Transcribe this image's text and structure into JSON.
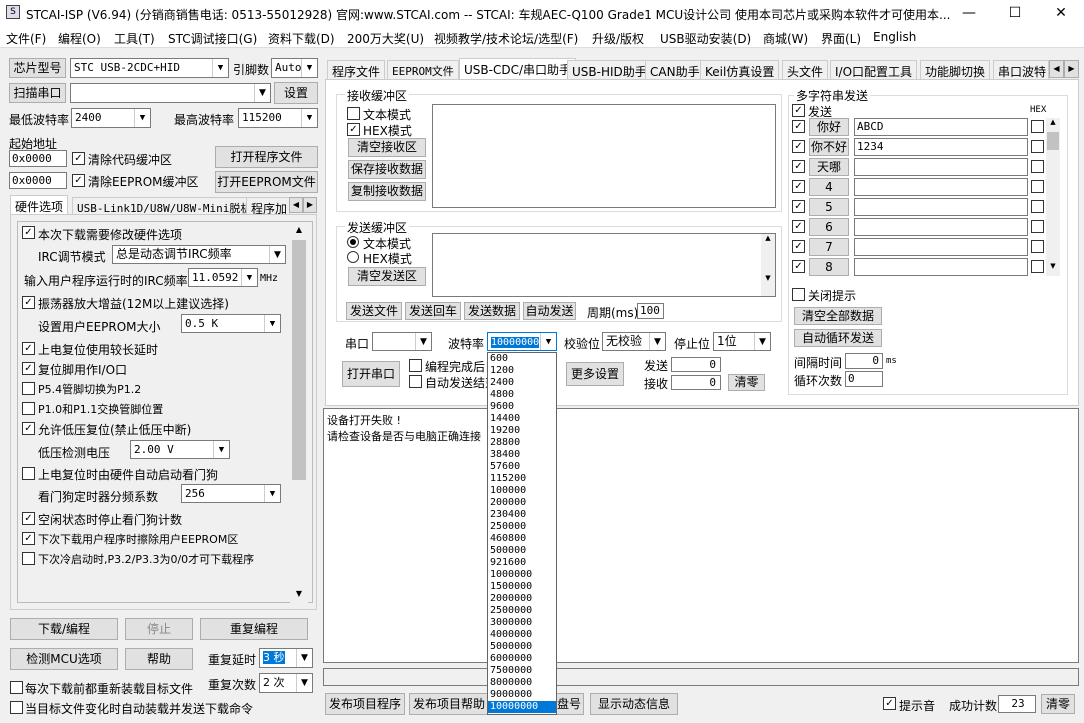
{
  "window": {
    "title": "STCAI-ISP (V6.94) (分销商销售电话: 0513-55012928) 官网:www.STCAI.com  -- STCAI: 车规AEC-Q100 Grade1 MCU设计公司 使用本司芯片或采购本软件才可使用本...",
    "min": "—",
    "max": "☐",
    "close": "✕"
  },
  "menu": [
    "文件(F)",
    "编程(O)",
    "工具(T)",
    "STC调试接口(G)",
    "资料下载(D)",
    "200万大奖(U)",
    "视频教学/技术论坛/选型(F)",
    "升级/版权",
    "USB驱动安装(D)",
    "商城(W)",
    "界面(L)",
    "English"
  ],
  "left": {
    "chip_btn": "芯片型号",
    "chip_value": "STC USB-2CDC+HID",
    "pin_label": "引脚数",
    "pin_value": "Auto",
    "scan_btn": "扫描串口",
    "port_value": "",
    "settings_btn": "设置",
    "min_baud_label": "最低波特率",
    "min_baud": "2400",
    "max_baud_label": "最高波特率",
    "max_baud": "115200",
    "start_addr_label": "起始地址",
    "addr1": "0x0000",
    "clear_code": "清除代码缓冲区",
    "open_prog": "打开程序文件",
    "addr2": "0x0000",
    "clear_eeprom": "清除EEPROM缓冲区",
    "open_eeprom": "打开EEPROM文件",
    "tabs": [
      "硬件选项",
      "USB-Link1D/U8W/U8W-Mini脱机",
      "程序加"
    ],
    "opt_modify": "本次下载需要修改硬件选项",
    "irc_mode_label": "IRC调节模式",
    "irc_mode": "总是动态调节IRC频率",
    "irc_freq_label": "输入用户程序运行时的IRC频率",
    "irc_freq": "11.0592",
    "irc_unit": "MHz",
    "osc_gain": "振荡器放大增益(12M以上建议选择)",
    "eeprom_size_label": "设置用户EEPROM大小",
    "eeprom_size": "0.5 K",
    "por_delay": "上电复位使用较长延时",
    "reset_io": "复位脚用作I/O口",
    "p54": "P5.4管脚切换为P1.2",
    "p10": "P1.0和P1.1交换管脚位置",
    "lvr": "允许低压复位(禁止低压中断)",
    "lvd_label": "低压检测电压",
    "lvd": "2.00 V",
    "wdt_auto": "上电复位时由硬件自动启动看门狗",
    "wdt_div_label": "看门狗定时器分频系数",
    "wdt_div": "256",
    "idle_wdt": "空闲状态时停止看门狗计数",
    "erase_eeprom": "下次下载用户程序时擦除用户EEPROM区",
    "p32": "下次冷启动时,P3.2/P3.3为0/0才可下载程序",
    "download_btn": "下载/编程",
    "stop_btn": "停止",
    "reprog_btn": "重复编程",
    "detect_btn": "检测MCU选项",
    "help_btn": "帮助",
    "delay_label": "重复延时",
    "delay_value": "3 秒",
    "reload_each": "每次下载前都重新装载目标文件",
    "count_label": "重复次数",
    "count_value": "2 次",
    "auto_reload": "当目标文件变化时自动装载并发送下载命令"
  },
  "right": {
    "tabs": [
      "程序文件",
      "EEPROM文件",
      "USB-CDC/串口助手",
      "USB-HID助手",
      "CAN助手",
      "Keil仿真设置",
      "头文件",
      "I/O口配置工具",
      "功能脚切换",
      "串口波特"
    ],
    "recv_group": "接收缓冲区",
    "text_mode": "文本模式",
    "hex_mode": "HEX模式",
    "clear_recv": "清空接收区",
    "save_recv": "保存接收数据",
    "copy_recv": "复制接收数据",
    "send_group": "发送缓冲区",
    "send_text": "文本模式",
    "send_hex": "HEX模式",
    "clear_send": "清空发送区",
    "send_file": "发送文件",
    "send_back": "发送回车",
    "send_data": "发送数据",
    "auto_send": "自动发送",
    "period_label": "周期(ms)",
    "period": "100",
    "port_label": "串口",
    "baud_label": "波特率",
    "baud_value": "10000000",
    "parity_label": "校验位",
    "parity": "无校验",
    "stop_label": "停止位",
    "stop": "1位",
    "open_port": "打开串口",
    "opt1": "编程完成后自",
    "opt2": "自动发送结束",
    "more_settings": "更多设置",
    "send_cnt_label": "发送",
    "send_cnt": "0",
    "recv_cnt_label": "接收",
    "recv_cnt": "0",
    "clear_cnt": "清零",
    "multi_group": "多字符串发送",
    "send_header": "发送",
    "hex_header": "HEX",
    "strings": [
      {
        "btn": "你好",
        "val": "ABCD"
      },
      {
        "btn": "你不好",
        "val": "1234"
      },
      {
        "btn": "天哪",
        "val": ""
      },
      {
        "btn": "4",
        "val": ""
      },
      {
        "btn": "5",
        "val": ""
      },
      {
        "btn": "6",
        "val": ""
      },
      {
        "btn": "7",
        "val": ""
      },
      {
        "btn": "8",
        "val": ""
      }
    ],
    "close_tip": "关闭提示",
    "clear_all": "清空全部数据",
    "auto_loop": "自动循环发送",
    "interval_label": "间隔时间",
    "interval": "0",
    "interval_unit": "ms",
    "loop_label": "循环次数",
    "loop": "0",
    "log": [
      "设备打开失败 !",
      "请检查设备是否与电脑正确连接"
    ],
    "publish_prog": "发布项目程序",
    "publish_help": "发布项目帮助",
    "disk_btn": "盘号",
    "dyn_info": "显示动态信息",
    "beep": "提示音",
    "success_label": "成功计数",
    "success": "23",
    "clear_success": "清零"
  },
  "baud_options": [
    "600",
    "1200",
    "2400",
    "4800",
    "9600",
    "14400",
    "19200",
    "28800",
    "38400",
    "57600",
    "115200",
    "100000",
    "200000",
    "230400",
    "250000",
    "460800",
    "500000",
    "921600",
    "1000000",
    "1500000",
    "2000000",
    "2500000",
    "3000000",
    "4000000",
    "5000000",
    "6000000",
    "7500000",
    "8000000",
    "9000000",
    "10000000"
  ]
}
